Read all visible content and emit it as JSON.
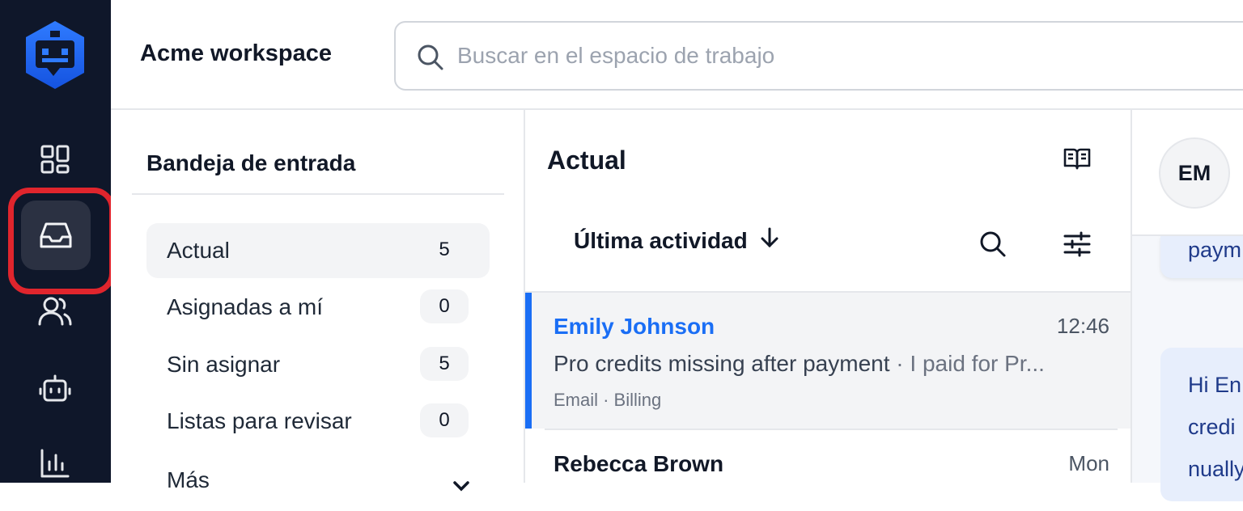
{
  "workspace": {
    "title": "Acme workspace"
  },
  "search": {
    "placeholder": "Buscar en el espacio de trabajo"
  },
  "rail": {
    "icons": [
      "bot-logo-icon",
      "dashboard-icon",
      "inbox-icon",
      "contacts-icon",
      "bot-icon",
      "reports-icon"
    ]
  },
  "inbox": {
    "title": "Bandeja de entrada",
    "items": [
      {
        "label": "Actual",
        "count": "5"
      },
      {
        "label": "Asignadas a mí",
        "count": "0"
      },
      {
        "label": "Sin asignar",
        "count": "5"
      },
      {
        "label": "Listas para revisar",
        "count": "0"
      },
      {
        "label": "Más"
      }
    ]
  },
  "list": {
    "title": "Actual",
    "sort_label": "Última actividad",
    "conversations": [
      {
        "name": "Emily Johnson",
        "time": "12:46",
        "subject": "Pro credits missing after payment",
        "separator": " · ",
        "snippet": "I paid for Pr...",
        "meta": "Email · Billing",
        "accent": "#1a6ef5"
      },
      {
        "name": "Rebecca Brown",
        "time": "Mon"
      }
    ]
  },
  "detail": {
    "avatar_initials": "EM",
    "message1": "paym",
    "message2_lines": [
      "Hi En",
      "credi",
      "nually"
    ]
  },
  "colors": {
    "rail_bg": "#0f172a",
    "highlight": "#e0252d",
    "accent": "#1a6ef5"
  }
}
